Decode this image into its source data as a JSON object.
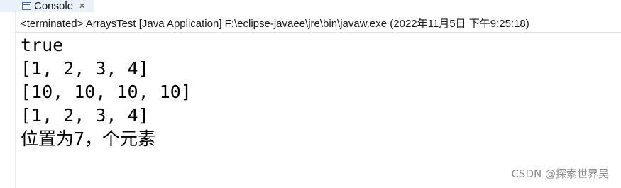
{
  "console_tab": {
    "label": "Console",
    "icon": "console-icon",
    "close_icon": "close-icon",
    "close_glyph": "✕"
  },
  "status_line": "<terminated> ArraysTest [Java Application] F:\\eclipse-javaee\\jre\\bin\\javaw.exe (2022年11月5日 下午9:25:18)",
  "output_lines": [
    "true",
    "[1, 2, 3, 4]",
    "[10, 10, 10, 10]",
    "[1, 2, 3, 4]",
    "位置为7，个元素"
  ],
  "watermark": "CSDN @探索世界吴"
}
